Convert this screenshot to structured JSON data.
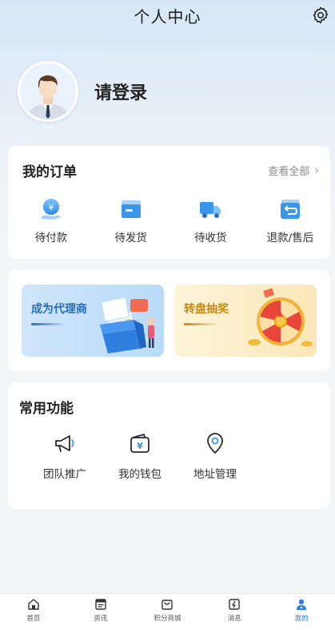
{
  "header": {
    "title": "个人中心",
    "settings_icon": "gear-icon"
  },
  "profile": {
    "login_text": "请登录",
    "avatar_icon": "default-avatar"
  },
  "orders": {
    "title": "我的订单",
    "view_all": "查看全部",
    "items": [
      {
        "label": "待付款",
        "icon": "pending-payment-icon"
      },
      {
        "label": "待发货",
        "icon": "pending-shipment-icon"
      },
      {
        "label": "待收货",
        "icon": "truck-icon"
      },
      {
        "label": "退款/售后",
        "icon": "refund-icon"
      }
    ]
  },
  "promo": {
    "agent": {
      "label": "成为代理商"
    },
    "lottery": {
      "label": "转盘抽奖"
    }
  },
  "functions": {
    "title": "常用功能",
    "items": [
      {
        "label": "团队推广",
        "icon": "megaphone-icon"
      },
      {
        "label": "我的钱包",
        "icon": "wallet-icon"
      },
      {
        "label": "地址管理",
        "icon": "location-pin-icon"
      }
    ]
  },
  "tabbar": {
    "items": [
      {
        "label": "首页",
        "icon": "home-icon",
        "active": false
      },
      {
        "label": "资讯",
        "icon": "news-icon",
        "active": false
      },
      {
        "label": "积分商城",
        "icon": "points-mall-icon",
        "active": false
      },
      {
        "label": "消息",
        "icon": "message-icon",
        "active": false
      },
      {
        "label": "我的",
        "icon": "profile-icon",
        "active": true
      }
    ]
  },
  "colors": {
    "accent": "#2d7be0",
    "icon_blue": "#4aa3f0",
    "agent_text": "#2b6fb7",
    "lottery_text": "#c48a12",
    "background": "#f4f5f7"
  }
}
